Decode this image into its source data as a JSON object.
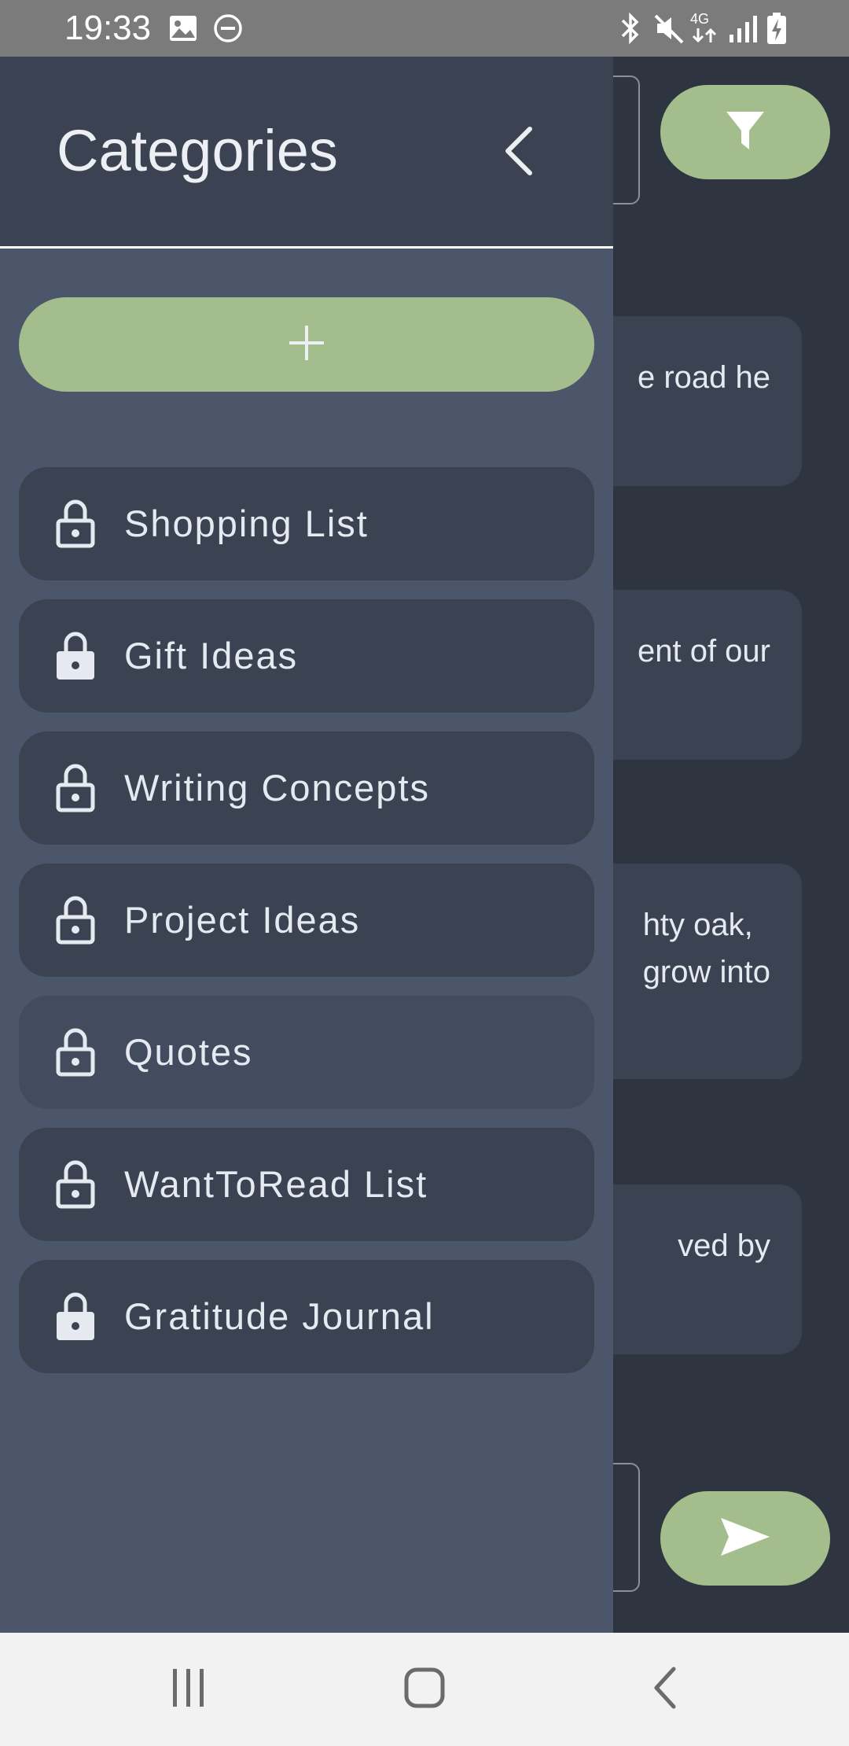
{
  "status_bar": {
    "time": "19:33",
    "icons": [
      "image-icon",
      "dnd-icon",
      "bluetooth-icon",
      "mute-icon",
      "network-4g-icon",
      "signal-icon",
      "battery-charging-icon"
    ],
    "network_label": "4G"
  },
  "drawer": {
    "title": "Categories",
    "close_icon": "chevron-left-icon",
    "add_icon": "plus-icon",
    "categories": [
      {
        "label": "Shopping List",
        "lock": "unlocked"
      },
      {
        "label": "Gift Ideas",
        "lock": "locked"
      },
      {
        "label": "Writing Concepts",
        "lock": "unlocked"
      },
      {
        "label": "Project Ideas",
        "lock": "unlocked"
      },
      {
        "label": "Quotes",
        "lock": "unlocked"
      },
      {
        "label": "WantToRead List",
        "lock": "unlocked"
      },
      {
        "label": "Gratitude Journal",
        "lock": "locked"
      }
    ]
  },
  "main": {
    "filter_icon": "filter-icon",
    "send_icon": "send-icon",
    "notes": [
      {
        "text": "e road he"
      },
      {
        "text": "ent of our"
      },
      {
        "text": "hty oak,\ngrow into"
      },
      {
        "text": "ved by"
      }
    ]
  },
  "navbar": {
    "icons": [
      "recent-apps-icon",
      "home-icon",
      "back-icon"
    ]
  },
  "colors": {
    "accent": "#a3be8c",
    "drawer_bg": "#4c566a",
    "header_bg": "#3b4252",
    "main_bg": "#2e3440",
    "text": "#e5e9f0"
  }
}
